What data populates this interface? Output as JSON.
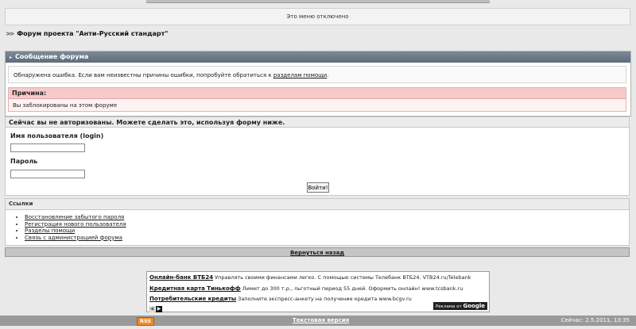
{
  "menu_disabled": "Это меню отключено",
  "breadcrumb": {
    "title": "Форум проекта \"Анти-Русский стандарт\""
  },
  "message_panel": {
    "title": "Сообщение форума",
    "error_text": "Обнаружена ошибка. Если вам неизвестны причины ошибки, попробуйте обратиться к",
    "help_link": "разделам помощи",
    "reason_title": "Причина:",
    "reason_text": "Вы заблокированы на этом форуме"
  },
  "login": {
    "title": "Сейчас вы не авторизованы. Можете сделать это, используя форму ниже.",
    "username_label": "Имя пользователя (login)",
    "password_label": "Пароль",
    "submit_label": "Войти!"
  },
  "links": {
    "title": "Ссылки",
    "items": [
      "Восстановление забытого пароля",
      "Регистрация нового пользователя",
      "Разделы помощи",
      "Связь с администрацией форума"
    ]
  },
  "back_link": "Вернуться назад",
  "ads": [
    {
      "title": "Онлайн-банк ВТБ24",
      "text": "Управлять своими финансами легко. С помощью системы Телебанк ВТБ24. VTB24.ru/Telebank"
    },
    {
      "title": "Кредитная карта Тинькофф",
      "text": "Лимит до 300 т.р., льготный период 55 дней. Оформить онлайн! www.tcsbank.ru"
    },
    {
      "title": "Потребительские кредиты",
      "text": "Заполните экспресс-анкету на получение кредита www.bcgv.ru"
    }
  ],
  "ads_badge": {
    "prefix": "Реклама от",
    "brand": "Google"
  },
  "footer": {
    "rss": "RSS",
    "text_version": "Текстовая версия",
    "now": "Сейчас: 2.5.2011, 13:35"
  },
  "colors": {
    "header_bg": "#6d7b88",
    "reason_bg": "#f7c9c9",
    "rss": "#f08a24"
  }
}
